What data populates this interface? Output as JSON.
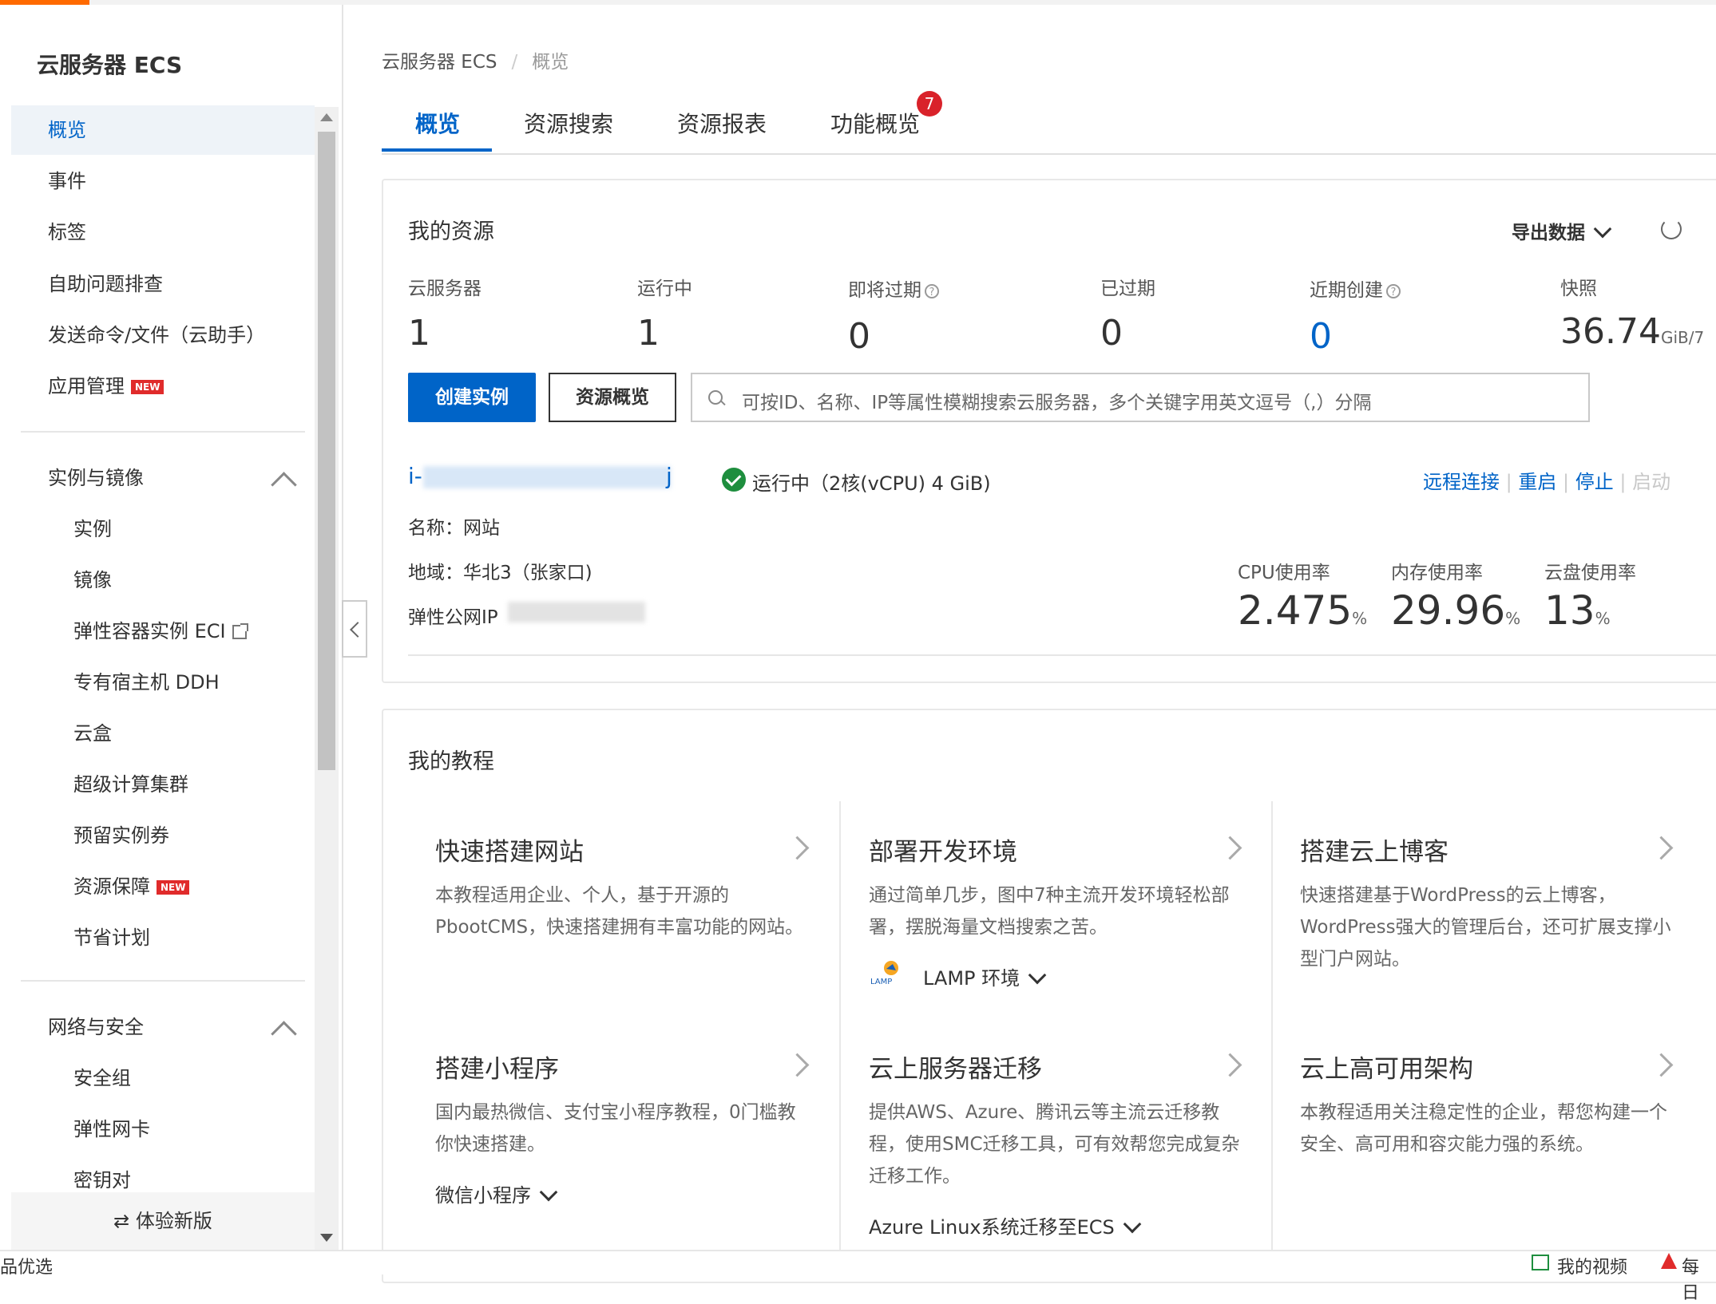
{
  "sidebar": {
    "title": "云服务器 ECS",
    "items": [
      {
        "label": "概览"
      },
      {
        "label": "事件"
      },
      {
        "label": "标签"
      },
      {
        "label": "自助问题排查"
      },
      {
        "label": "发送命令/文件（云助手）"
      },
      {
        "label": "应用管理",
        "badge": "NEW"
      }
    ],
    "groups": [
      {
        "label": "实例与镜像",
        "items": [
          {
            "label": "实例"
          },
          {
            "label": "镜像"
          },
          {
            "label": "弹性容器实例 ECI"
          },
          {
            "label": "专有宿主机 DDH"
          },
          {
            "label": "云盒"
          },
          {
            "label": "超级计算集群"
          },
          {
            "label": "预留实例券"
          },
          {
            "label": "资源保障",
            "badge": "NEW"
          },
          {
            "label": "节省计划"
          }
        ]
      },
      {
        "label": "网络与安全",
        "items": [
          {
            "label": "安全组"
          },
          {
            "label": "弹性网卡"
          },
          {
            "label": "密钥对"
          }
        ]
      }
    ],
    "footer": "⇄ 体验新版"
  },
  "breadcrumb": {
    "root": "云服务器 ECS",
    "sep": "/",
    "current": "概览"
  },
  "tabs": [
    {
      "label": "概览"
    },
    {
      "label": "资源搜索"
    },
    {
      "label": "资源报表"
    },
    {
      "label": "功能概览",
      "badge": "7"
    }
  ],
  "resources": {
    "title": "我的资源",
    "export_label": "导出数据",
    "stats": [
      {
        "label": "云服务器",
        "value": "1"
      },
      {
        "label": "运行中",
        "value": "1"
      },
      {
        "label": "即将过期",
        "value": "0",
        "help": "?"
      },
      {
        "label": "已过期",
        "value": "0"
      },
      {
        "label": "近期创建",
        "value": "0",
        "help": "?"
      },
      {
        "label": "快照",
        "value": "36.74",
        "unit": "GiB/7"
      }
    ],
    "create_button": "创建实例",
    "overview_button": "资源概览",
    "search_placeholder": "可按ID、名称、IP等属性模糊搜索云服务器，多个关键字用英文逗号（,）分隔",
    "instance": {
      "id_prefix": "i-",
      "id_suffix": "j",
      "status": "运行中（2核(vCPU) 4 GiB)",
      "name_label": "名称：",
      "name_value": "网站",
      "region_label": "地域：",
      "region_value": "华北3（张家口)",
      "ip_label": "弹性公网IP",
      "actions": [
        "远程连接",
        "重启",
        "停止",
        "启动"
      ],
      "metrics": [
        {
          "label": "CPU使用率",
          "value": "2.475",
          "unit": "%"
        },
        {
          "label": "内存使用率",
          "value": "29.96",
          "unit": "%"
        },
        {
          "label": "云盘使用率",
          "value": "13",
          "unit": "%"
        }
      ]
    }
  },
  "tutorials": {
    "title": "我的教程",
    "items": [
      {
        "title": "快速搭建网站",
        "desc": "本教程适用企业、个人，基于开源的PbootCMS，快速搭建拥有丰富功能的网站。"
      },
      {
        "title": "部署开发环境",
        "desc": "通过简单几步，图中7种主流开发环境轻松部署，摆脱海量文档搜索之苦。",
        "link": "LAMP 环境",
        "logo": "LAMP"
      },
      {
        "title": "搭建云上博客",
        "desc": "快速搭建基于WordPress的云上博客，WordPress强大的管理后台，还可扩展支撑小型门户网站。"
      },
      {
        "title": "搭建小程序",
        "desc": "国内最热微信、支付宝小程序教程，0门槛教你快速搭建。",
        "link": "微信小程序"
      },
      {
        "title": "云上服务器迁移",
        "desc": "提供AWS、Azure、腾讯云等主流云迁移教程，使用SMC迁移工具，可有效帮您完成复杂迁移工作。",
        "link": "Azure Linux系统迁移至ECS"
      },
      {
        "title": "云上高可用架构",
        "desc": "本教程适用关注稳定性的企业，帮您构建一个安全、高可用和容灾能力强的系统。"
      }
    ]
  },
  "bottom_bar": {
    "left": "品优选",
    "right1": "我的视频",
    "right2": "每日"
  }
}
